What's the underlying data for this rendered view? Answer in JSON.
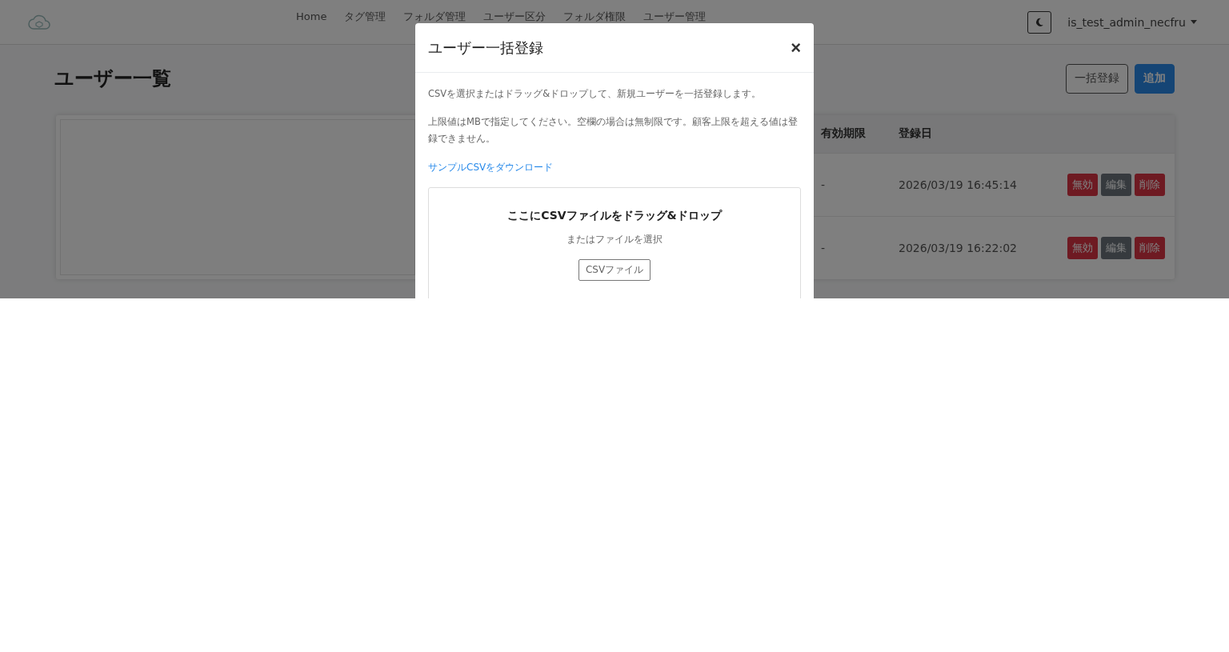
{
  "navbar": {
    "links": [
      {
        "label": "Home"
      },
      {
        "label": "タグ管理"
      },
      {
        "label": "フォルダ管理"
      },
      {
        "label": "ユーザー区分"
      },
      {
        "label": "フォルダ権限"
      },
      {
        "label": "ユーザー管理"
      }
    ],
    "user": "is_test_admin_necfru"
  },
  "page": {
    "title": "ユーザー一覧",
    "buttons": [
      {
        "label": "一括登録",
        "kind": "outline"
      },
      {
        "label": "追加",
        "kind": "primary"
      }
    ]
  },
  "table": {
    "columns": [
      "有効期限",
      "登録日"
    ],
    "rows": [
      {
        "cells": [
          "-",
          "2026/03/19 16:45:14"
        ],
        "actions": [
          {
            "label": "無効",
            "kind": "danger"
          },
          {
            "label": "編集",
            "kind": "dark"
          },
          {
            "label": "削除",
            "kind": "danger"
          }
        ]
      },
      {
        "cells": [
          "-",
          "2026/03/19 16:22:02"
        ],
        "actions": [
          {
            "label": "無効",
            "kind": "danger"
          },
          {
            "label": "編集",
            "kind": "dark"
          },
          {
            "label": "削除",
            "kind": "danger"
          }
        ]
      }
    ]
  },
  "modal": {
    "title": "ユーザー一括登録",
    "close": "×",
    "paragraphs": [
      "CSVを選択またはドラッグ&ドロップして、新規ユーザーを一括登録します。",
      "上限値はMBで指定してください。空欄の場合は無制限です。顧客上限を超える値は登録できません。"
    ],
    "link": "サンプルCSVをダウンロード",
    "dropzone": {
      "heading": "ここにCSVファイルをドラッグ&ドロップ",
      "subtext": "またはファイルを選択",
      "button": "CSVファイル"
    }
  }
}
